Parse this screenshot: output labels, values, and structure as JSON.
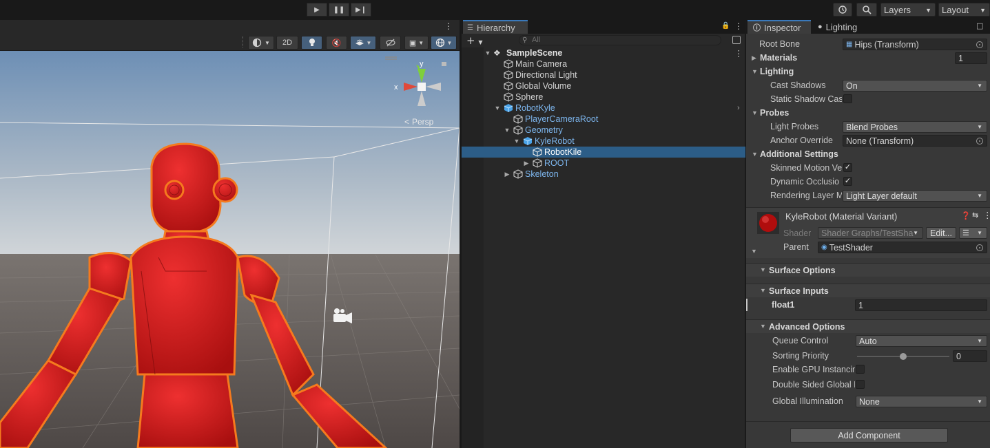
{
  "toolbar": {
    "play_icon": "play-icon",
    "pause_icon": "pause-icon",
    "step_icon": "step-icon",
    "layers_label": "Layers",
    "layout_label": "Layout"
  },
  "scene": {
    "toolbar_2d": "2D",
    "persp_label": "Persp",
    "gizmo_axis_y": "y",
    "gizmo_axis_x": "x"
  },
  "hierarchy": {
    "tab_label": "Hierarchy",
    "search_placeholder": "All",
    "items": [
      {
        "label": "SampleScene",
        "kind": "scene"
      },
      {
        "label": "Main Camera",
        "kind": "object"
      },
      {
        "label": "Directional Light",
        "kind": "object"
      },
      {
        "label": "Global Volume",
        "kind": "object"
      },
      {
        "label": "Sphere",
        "kind": "object"
      },
      {
        "label": "RobotKyle",
        "kind": "prefab-root"
      },
      {
        "label": "PlayerCameraRoot",
        "kind": "prefab"
      },
      {
        "label": "Geometry",
        "kind": "prefab"
      },
      {
        "label": "KyleRobot",
        "kind": "prefab-root"
      },
      {
        "label": "RobotKile",
        "kind": "prefab",
        "selected": true
      },
      {
        "label": "ROOT",
        "kind": "prefab"
      },
      {
        "label": "Skeleton",
        "kind": "prefab"
      }
    ]
  },
  "inspector": {
    "tab_inspector": "Inspector",
    "tab_lighting": "Lighting",
    "root_bone_label": "Root Bone",
    "root_bone_value": "Hips (Transform)",
    "materials_label": "Materials",
    "materials_count": "1",
    "lighting_header": "Lighting",
    "cast_shadows_label": "Cast Shadows",
    "cast_shadows_value": "On",
    "static_shadow_label": "Static Shadow Cas",
    "probes_header": "Probes",
    "light_probes_label": "Light Probes",
    "light_probes_value": "Blend Probes",
    "anchor_override_label": "Anchor Override",
    "anchor_override_value": "None (Transform)",
    "additional_header": "Additional Settings",
    "skinned_motion_label": "Skinned Motion Ve",
    "dynamic_occlusion_label": "Dynamic Occlusio",
    "rendering_layer_label": "Rendering Layer M",
    "rendering_layer_value": "Light Layer default",
    "material_title": "KyleRobot (Material Variant)",
    "shader_label": "Shader",
    "shader_value": "Shader Graphs/TestSha",
    "edit_button": "Edit...",
    "parent_label": "Parent",
    "parent_value": "TestShader",
    "surface_options_header": "Surface Options",
    "surface_inputs_header": "Surface Inputs",
    "float1_label": "float1",
    "float1_value": "1",
    "advanced_header": "Advanced Options",
    "queue_control_label": "Queue Control",
    "queue_control_value": "Auto",
    "sorting_priority_label": "Sorting Priority",
    "sorting_priority_value": "0",
    "sorting_priority_slider_fraction": 0.5,
    "gpu_instancing_label": "Enable GPU Instancin",
    "double_sided_label": "Double Sided Global I",
    "global_illum_label": "Global Illumination",
    "global_illum_value": "None",
    "add_component_button": "Add Component"
  },
  "colors": {
    "accent_blue": "#3a79bb",
    "selection": "#2c5d87",
    "prefab_text": "#7db6ee",
    "robot_red": "#d81b1b",
    "outline_orange": "#f57a1e"
  }
}
